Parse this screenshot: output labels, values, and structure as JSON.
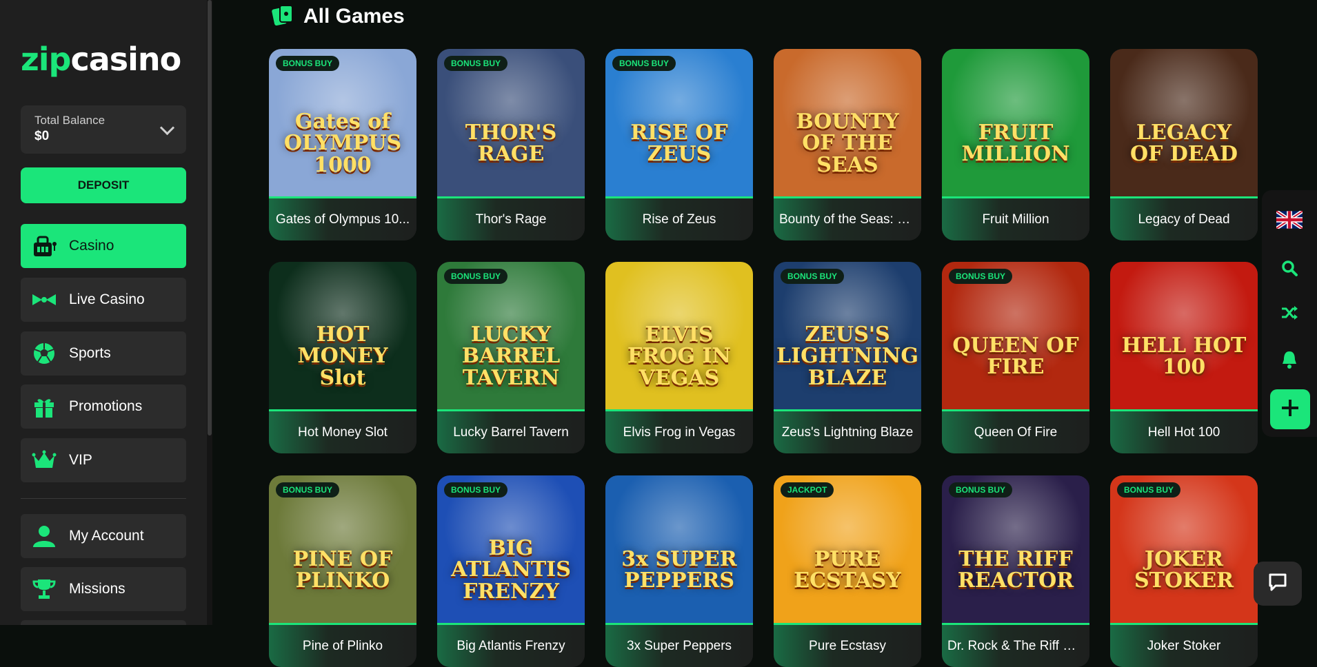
{
  "brand": {
    "logo_part1": "zip",
    "logo_part2": "casino",
    "accent": "#1be57a"
  },
  "balance": {
    "label": "Total Balance",
    "amount": "$0"
  },
  "deposit_label": "DEPOSIT",
  "nav": [
    {
      "label": "Casino",
      "icon": "casino-icon"
    },
    {
      "label": "Live Casino",
      "icon": "live-casino-icon"
    },
    {
      "label": "Sports",
      "icon": "soccer-ball-icon"
    },
    {
      "label": "Promotions",
      "icon": "gift-icon"
    },
    {
      "label": "VIP",
      "icon": "crown-icon"
    },
    {
      "label": "My Account",
      "icon": "user-icon"
    },
    {
      "label": "Missions",
      "icon": "trophy-icon"
    }
  ],
  "section": {
    "title": "All Games",
    "icon": "cards-icon"
  },
  "games": [
    {
      "name": "Gates of Olympus 10...",
      "badge": "BONUS BUY",
      "art": "Gates of OLYMPUS 1000",
      "bg": "#8aa7d6"
    },
    {
      "name": "Thor's Rage",
      "badge": "BONUS BUY",
      "art": "THOR'S RAGE",
      "bg": "#3a4f7a"
    },
    {
      "name": "Rise of Zeus",
      "badge": "BONUS BUY",
      "art": "RISE OF ZEUS",
      "bg": "#2a7fd1"
    },
    {
      "name": "Bounty of the Seas: H...",
      "badge": "",
      "art": "BOUNTY OF THE SEAS",
      "bg": "#c96a2c"
    },
    {
      "name": "Fruit Million",
      "badge": "",
      "art": "FRUIT MILLION",
      "bg": "#1f9a3a"
    },
    {
      "name": "Legacy of Dead",
      "badge": "",
      "art": "LEGACY OF DEAD",
      "bg": "#4a2a1a"
    },
    {
      "name": "Hot Money Slot",
      "badge": "",
      "art": "HOT MONEY Slot",
      "bg": "#0d2e1c"
    },
    {
      "name": "Lucky Barrel Tavern",
      "badge": "BONUS BUY",
      "art": "LUCKY BARREL TAVERN",
      "bg": "#2e7a3a"
    },
    {
      "name": "Elvis Frog in Vegas",
      "badge": "",
      "art": "ELVIS FROG IN VEGAS",
      "bg": "#e0c020"
    },
    {
      "name": "Zeus's Lightning Blaze",
      "badge": "BONUS BUY",
      "art": "ZEUS'S LIGHTNING BLAZE",
      "bg": "#1d3e6e"
    },
    {
      "name": "Queen Of Fire",
      "badge": "BONUS BUY",
      "art": "QUEEN OF FIRE",
      "bg": "#b2280f"
    },
    {
      "name": "Hell Hot 100",
      "badge": "",
      "art": "HELL HOT 100",
      "bg": "#c31a10"
    },
    {
      "name": "Pine of Plinko",
      "badge": "BONUS BUY",
      "art": "PINE OF PLINKO",
      "bg": "#6d7a3a"
    },
    {
      "name": "Big Atlantis Frenzy",
      "badge": "BONUS BUY",
      "art": "BIG ATLANTIS FRENZY",
      "bg": "#1e4fb5"
    },
    {
      "name": "3x Super Peppers",
      "badge": "",
      "art": "3x SUPER PEPPERS",
      "bg": "#1b5fb0"
    },
    {
      "name": "Pure Ecstasy",
      "badge": "JACKPOT",
      "art": "PURE ECSTASY",
      "bg": "#f0a21a"
    },
    {
      "name": "Dr. Rock & The Riff Reactor",
      "badge": "BONUS BUY",
      "art": "THE RIFF REACTOR",
      "bg": "#2a1f4a"
    },
    {
      "name": "Joker Stoker",
      "badge": "BONUS BUY",
      "art": "JOKER STOKER",
      "bg": "#d4361a"
    }
  ],
  "rail": [
    {
      "icon": "uk-flag-icon"
    },
    {
      "icon": "search-icon"
    },
    {
      "icon": "shuffle-icon"
    },
    {
      "icon": "bell-icon"
    },
    {
      "icon": "plus-icon"
    }
  ],
  "chat_icon": "chat-icon"
}
